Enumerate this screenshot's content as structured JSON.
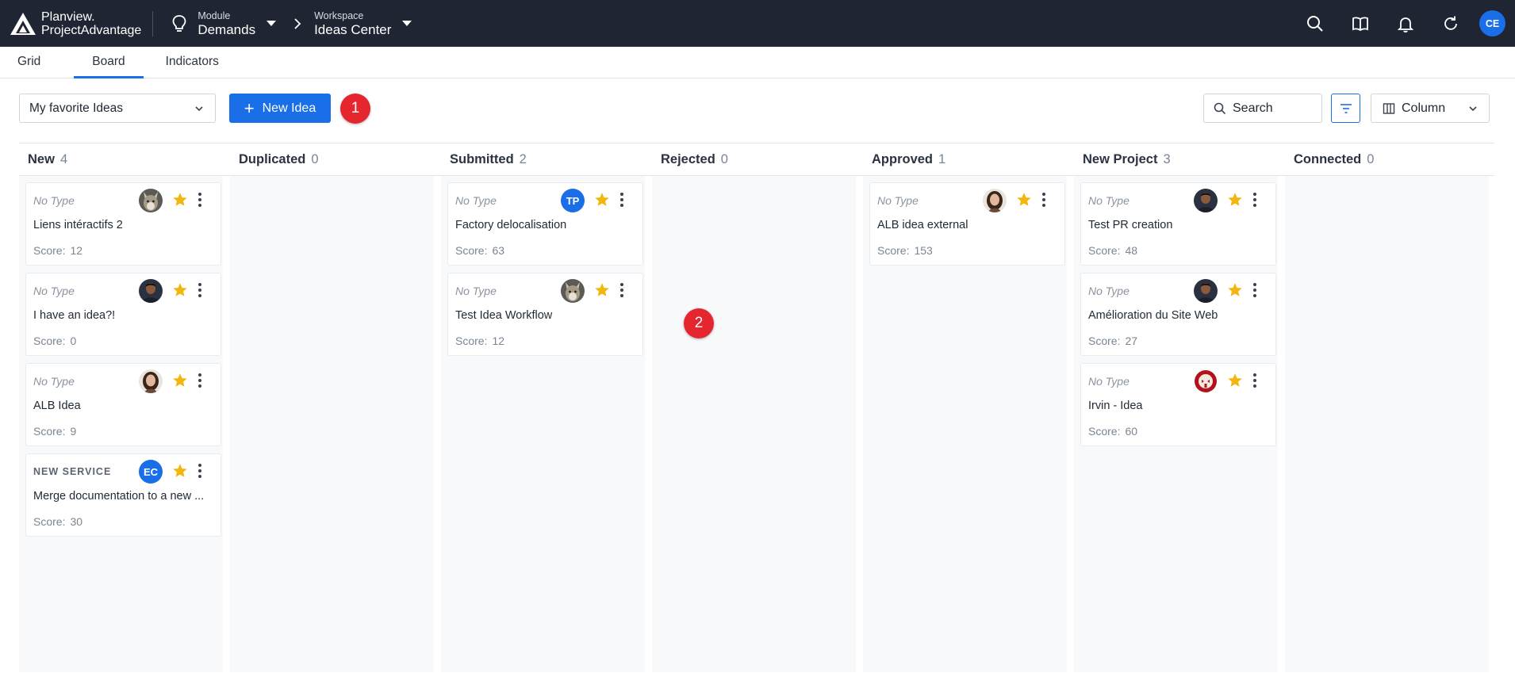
{
  "app": {
    "brand_line1": "Planview.",
    "brand_line2": "ProjectAdvantage",
    "module_label": "Module",
    "module_value": "Demands",
    "workspace_label": "Workspace",
    "workspace_value": "Ideas Center",
    "user_initials": "CE",
    "user_avatar_color": "#1a6ee8",
    "icons": [
      "search-icon",
      "book-icon",
      "bell-icon",
      "refresh-icon"
    ]
  },
  "tabs": [
    {
      "label": "Grid",
      "active": false
    },
    {
      "label": "Board",
      "active": true
    },
    {
      "label": "Indicators",
      "active": false
    }
  ],
  "toolbar": {
    "view_select_value": "My favorite Ideas",
    "new_button_label": "New Idea",
    "search_label": "Search",
    "column_label": "Column",
    "accent_color": "#1a6ee8"
  },
  "markers": [
    "1",
    "2"
  ],
  "columns": [
    {
      "name": "New",
      "count": "4",
      "cards": [
        {
          "type": "No Type",
          "title": "Liens intéractifs 2",
          "score_label": "Score:",
          "score": "12",
          "avatar": "photo-wolf"
        },
        {
          "type": "No Type",
          "title": "I have an idea?!",
          "score_label": "Score:",
          "score": "0",
          "avatar": "photo-man"
        },
        {
          "type": "No Type",
          "title": "ALB Idea",
          "score_label": "Score:",
          "score": "9",
          "avatar": "photo-woman"
        },
        {
          "type": "NEW SERVICE",
          "title": "Merge documentation to a new ...",
          "score_label": "Score:",
          "score": "30",
          "avatar": "initials",
          "initials": "EC"
        }
      ]
    },
    {
      "name": "Duplicated",
      "count": "0",
      "cards": []
    },
    {
      "name": "Submitted",
      "count": "2",
      "cards": [
        {
          "type": "No Type",
          "title": "Factory delocalisation",
          "score_label": "Score:",
          "score": "63",
          "avatar": "initials",
          "initials": "TP"
        },
        {
          "type": "No Type",
          "title": "Test Idea Workflow",
          "score_label": "Score:",
          "score": "12",
          "avatar": "photo-wolf"
        }
      ]
    },
    {
      "name": "Rejected",
      "count": "0",
      "cards": []
    },
    {
      "name": "Approved",
      "count": "1",
      "cards": [
        {
          "type": "No Type",
          "title": "ALB idea external",
          "score_label": "Score:",
          "score": "153",
          "avatar": "photo-woman"
        }
      ]
    },
    {
      "name": "New Project",
      "count": "3",
      "cards": [
        {
          "type": "No Type",
          "title": "Test PR creation",
          "score_label": "Score:",
          "score": "48",
          "avatar": "photo-man"
        },
        {
          "type": "No Type",
          "title": "Amélioration du Site Web",
          "score_label": "Score:",
          "score": "27",
          "avatar": "photo-man"
        },
        {
          "type": "No Type",
          "title": "Irvin - Idea",
          "score_label": "Score:",
          "score": "60",
          "avatar": "photo-mask"
        }
      ]
    },
    {
      "name": "Connected",
      "count": "0",
      "cards": []
    }
  ],
  "colors": {
    "topbar": "#1f2533",
    "star": "#f2b60c",
    "marker": "#e5262f"
  }
}
